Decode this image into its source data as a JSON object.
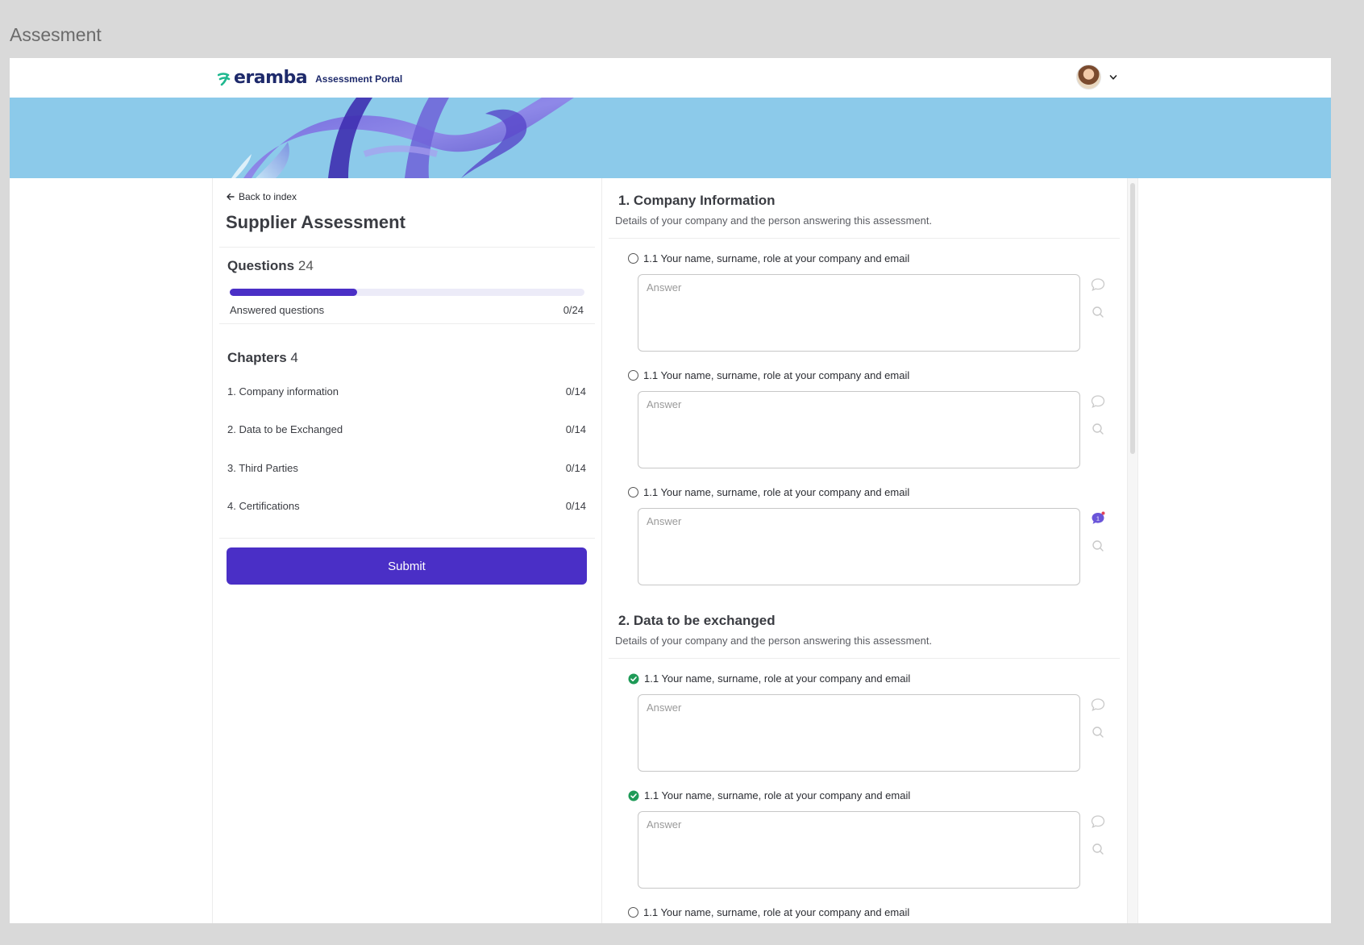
{
  "canvas": {
    "title": "Assesment"
  },
  "header": {
    "brand": "eramba",
    "portal_label": "Assessment Portal",
    "colors": {
      "brand": "#1e2a6b",
      "accent": "#4a2fc6",
      "banner": "#8ccaea",
      "success": "#1e9a57"
    }
  },
  "sidebar": {
    "back_label": "Back to index",
    "title": "Supplier Assessment",
    "questions_label": "Questions",
    "questions_count": "24",
    "answered_label": "Answered questions",
    "answered_value": "0/24",
    "answered_fraction": 0.36,
    "chapters_label": "Chapters",
    "chapters_count": "4",
    "chapters": [
      {
        "label": "1. Company information",
        "count": "0/14"
      },
      {
        "label": "2. Data to be Exchanged",
        "count": "0/14"
      },
      {
        "label": "3. Third Parties",
        "count": "0/14"
      },
      {
        "label": "4. Certifications",
        "count": "0/14"
      }
    ],
    "submit_label": "Submit"
  },
  "main": {
    "sections": [
      {
        "title": "1. Company Information",
        "description": "Details of your company and the person answering this assessment.",
        "questions": [
          {
            "label": "1.1 Your name, surname, role at your company and email",
            "placeholder": "Answer",
            "answered": false,
            "comment_count": null
          },
          {
            "label": "1.1 Your name, surname, role at your company and email",
            "placeholder": "Answer",
            "answered": false,
            "comment_count": null
          },
          {
            "label": "1.1 Your name, surname, role at your company and email",
            "placeholder": "Answer",
            "answered": false,
            "comment_count": "1"
          }
        ]
      },
      {
        "title": "2. Data to be exchanged",
        "description": "Details of your company and the person answering this assessment.",
        "questions": [
          {
            "label": "1.1 Your name, surname, role at your company and email",
            "placeholder": "Answer",
            "answered": true,
            "comment_count": null
          },
          {
            "label": "1.1 Your name, surname, role at your company and email",
            "placeholder": "Answer",
            "answered": true,
            "comment_count": null
          },
          {
            "label": "1.1 Your name, surname, role at your company and email",
            "placeholder": "Answer",
            "answered": false,
            "comment_count": null
          }
        ]
      }
    ]
  }
}
